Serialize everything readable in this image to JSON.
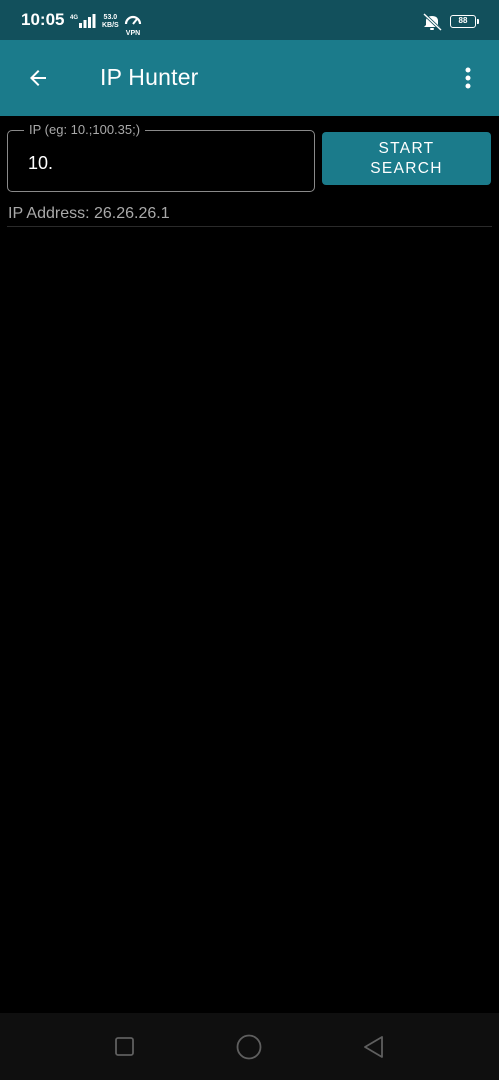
{
  "status_bar": {
    "time": "10:05",
    "network_speed_value": "53.0",
    "network_speed_unit": "KB/S",
    "vpn_label": "VPN",
    "network_type": "4G",
    "battery_level": "88",
    "icons": [
      "signal-icon",
      "vpn-icon",
      "mute-icon",
      "battery-icon"
    ]
  },
  "app_bar": {
    "title": "IP Hunter",
    "back_icon": "arrow-back-icon",
    "menu_icon": "more-vert-icon",
    "background_color": "#1b7b8b"
  },
  "search": {
    "field_label": "IP (eg: 10.;100.35;)",
    "value": "10.",
    "button_label": "START SEARCH"
  },
  "result": {
    "ip_address_text": "IP Address: 26.26.26.1"
  },
  "nav_bar": {
    "icons": [
      "recents-square-icon",
      "home-circle-icon",
      "back-triangle-icon"
    ]
  }
}
